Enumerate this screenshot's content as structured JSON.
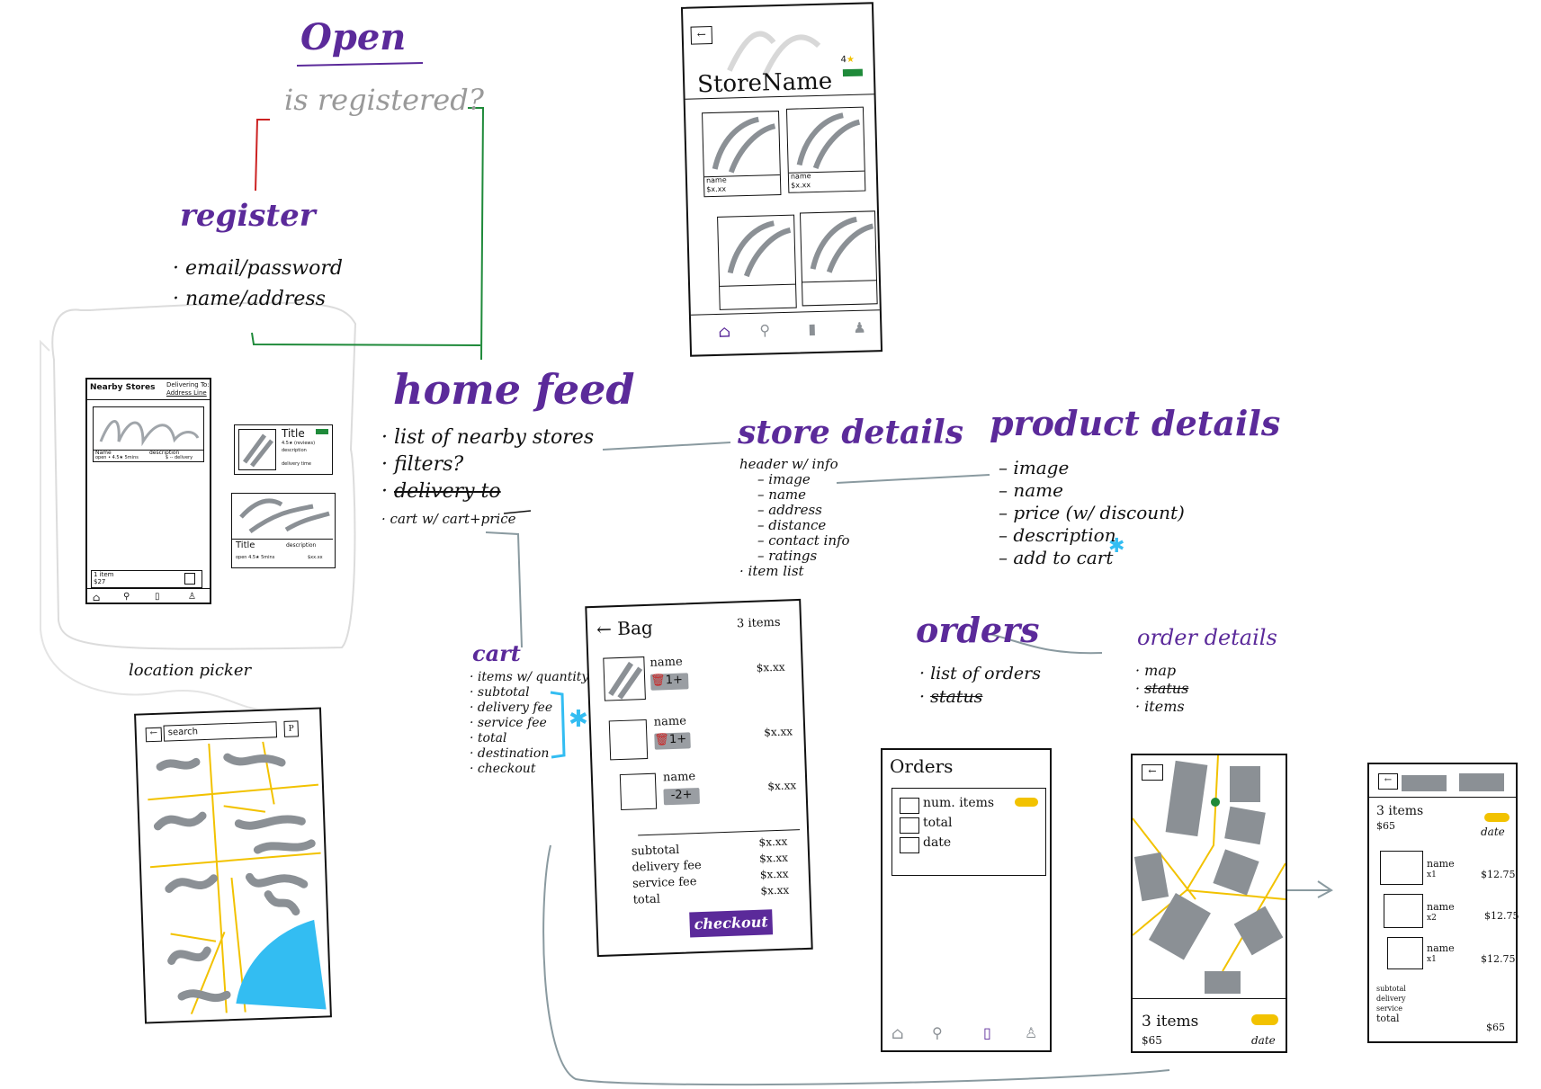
{
  "flow": {
    "open": "Open",
    "is_registered": "is registered?",
    "register": {
      "title": "register",
      "items": [
        "email/password",
        "name/address"
      ]
    },
    "home_feed": {
      "title": "home feed",
      "items": [
        "list of nearby stores",
        "filters?",
        "delivery to",
        "cart w/ cart+price"
      ]
    },
    "store_details": {
      "title": "store details",
      "header_item": "header w/ info",
      "sub_items": [
        "image",
        "name",
        "address",
        "distance",
        "contact info",
        "ratings"
      ],
      "last_item": "item list"
    },
    "product_details": {
      "title": "product details",
      "items": [
        "image",
        "name",
        "price (w/ discount)",
        "description",
        "add to cart"
      ]
    },
    "cart": {
      "title": "cart",
      "items": [
        "items w/ quantity",
        "subtotal",
        "delivery fee",
        "service fee",
        "total",
        "destination",
        "checkout"
      ]
    },
    "orders": {
      "title": "orders",
      "items": [
        "list of orders",
        "status"
      ]
    },
    "order_details": {
      "title": "order details",
      "items": [
        "map",
        "status",
        "items"
      ]
    },
    "location_picker": "location picker"
  },
  "home_mock": {
    "header_left": "Nearby Stores",
    "header_right_top": "Delivering To:",
    "header_right_bottom": "Address Line",
    "card_name": "Name",
    "card_desc": "description",
    "card_meta": "open • 4.5★ 5mins",
    "card_delivery": "$ -- delivery",
    "cart_items": "1 item",
    "cart_total": "$27",
    "alt_card_title": "Title",
    "alt_card_meta": "4.5★ (reviews)",
    "alt_card_desc": "description",
    "alt_card_delivery": "delivery time",
    "wide_card_title": "Title",
    "wide_card_desc": "description",
    "wide_card_meta": "open 4.5★ 5mins",
    "wide_card_price": "$xx.xx"
  },
  "store_mock": {
    "store_name": "StoreName",
    "rating": "4",
    "products": [
      {
        "name": "name",
        "price": "$x.xx"
      },
      {
        "name": "name",
        "price": "$x.xx"
      }
    ]
  },
  "bag_mock": {
    "title": "Bag",
    "count": "3 items",
    "items": [
      {
        "name": "name",
        "qty": "1",
        "price": "$x.xx"
      },
      {
        "name": "name",
        "qty": "1",
        "price": "$x.xx"
      },
      {
        "name": "name",
        "qty": "2",
        "price": "$x.xx"
      }
    ],
    "summary": [
      {
        "label": "subtotal",
        "value": "$x.xx"
      },
      {
        "label": "delivery fee",
        "value": "$x.xx"
      },
      {
        "label": "service fee",
        "value": "$x.xx"
      },
      {
        "label": "total",
        "value": "$x.xx"
      }
    ],
    "checkout": "checkout"
  },
  "search_mock": {
    "search_placeholder": "search"
  },
  "orders_mock": {
    "title": "Orders",
    "fields": [
      "num. items",
      "total",
      "date"
    ]
  },
  "map_mock": {
    "items": "3 items",
    "price": "$65",
    "date": "date"
  },
  "receipt_mock": {
    "count": "3 items",
    "price": "$65",
    "date": "date",
    "items": [
      {
        "name": "name",
        "qty": "x1",
        "price": "$12.75"
      },
      {
        "name": "name",
        "qty": "x2",
        "price": "$12.75"
      },
      {
        "name": "name",
        "qty": "x1",
        "price": "$12.75"
      }
    ],
    "summary": [
      "subtotal",
      "delivery",
      "service",
      "total"
    ],
    "total_value": "$65"
  },
  "colors": {
    "heading": "#5b2a9a",
    "red": "#cc2222",
    "green": "#1f8a3a",
    "connector": "#8a9aa0",
    "yellow": "#f2c200",
    "blue": "#33bdf2",
    "gray_scribble": "#8b9095"
  }
}
